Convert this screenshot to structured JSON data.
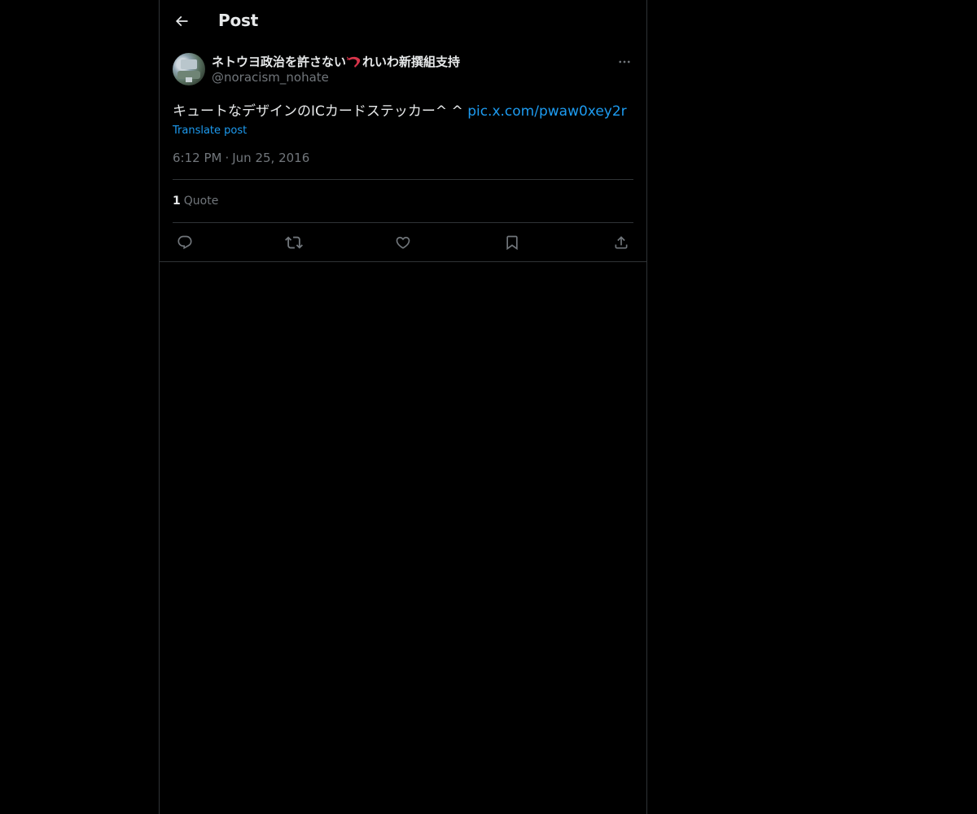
{
  "header": {
    "title": "Post",
    "back_icon": "arrow-left-icon"
  },
  "post": {
    "author": {
      "display_name_before": "ネトウヨ政治を許さない",
      "display_name_emoji": "shrimp-emoji",
      "display_name_after": "れいわ新撰組支持",
      "handle": "@noracism_nohate"
    },
    "text": "キュートなデザインのICカードステッカー^ ^ ",
    "link": "pic.x.com/pwaw0xey2r",
    "translate_label": "Translate post",
    "time": "6:12 PM",
    "separator": "·",
    "date": "Jun 25, 2016",
    "stats": {
      "quote_count": "1",
      "quote_label": "Quote"
    },
    "actions": [
      "reply-icon",
      "repost-icon",
      "like-icon",
      "bookmark-icon",
      "share-icon"
    ]
  },
  "colors": {
    "background": "#000000",
    "text_primary": "#e7e9ea",
    "text_secondary": "#71767b",
    "accent": "#1d9bf0",
    "border": "#2f3336"
  }
}
